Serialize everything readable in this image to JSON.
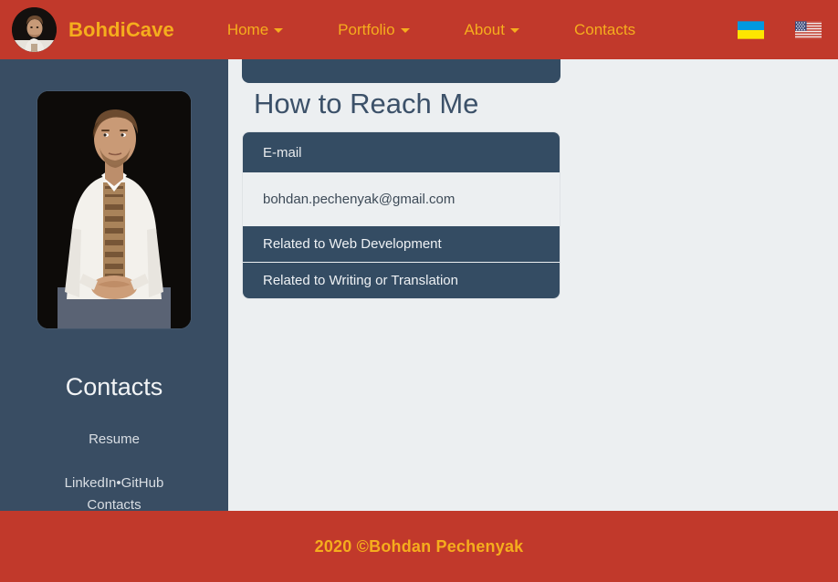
{
  "navbar": {
    "brand": "BohdiCave",
    "avatar_icon": "user-avatar-photo",
    "links": [
      {
        "label": "Home",
        "has_dropdown": true
      },
      {
        "label": "Portfolio",
        "has_dropdown": true
      },
      {
        "label": "About",
        "has_dropdown": true
      },
      {
        "label": "Contacts",
        "has_dropdown": false
      }
    ],
    "flags": [
      {
        "name": "ukraine-flag",
        "title": "Ukrainian"
      },
      {
        "name": "usa-flag",
        "title": "English"
      }
    ],
    "background_color": "#c1392b",
    "link_color": "#f5ad1d"
  },
  "sidebar": {
    "portrait_icon": "portrait-photo",
    "title": "Contacts",
    "resume_link": "Resume",
    "links": [
      {
        "label": "LinkedIn"
      },
      {
        "label": "GitHub"
      },
      {
        "label": "Contacts"
      }
    ],
    "separator": "•",
    "background_color": "#394d63"
  },
  "main": {
    "heading": "How to Reach Me",
    "heading_color": "#3c5169",
    "card": {
      "header": "E-mail",
      "email": "bohdan.pechenyak@gmail.com",
      "actions": [
        {
          "label": "Related to Web Development"
        },
        {
          "label": "Related to Writing or Translation"
        }
      ]
    },
    "background_color": "#eceff1"
  },
  "footer": {
    "text": "2020 ©Bohdan Pechenyak",
    "background_color": "#c1392b",
    "text_color": "#f5ad1d"
  }
}
